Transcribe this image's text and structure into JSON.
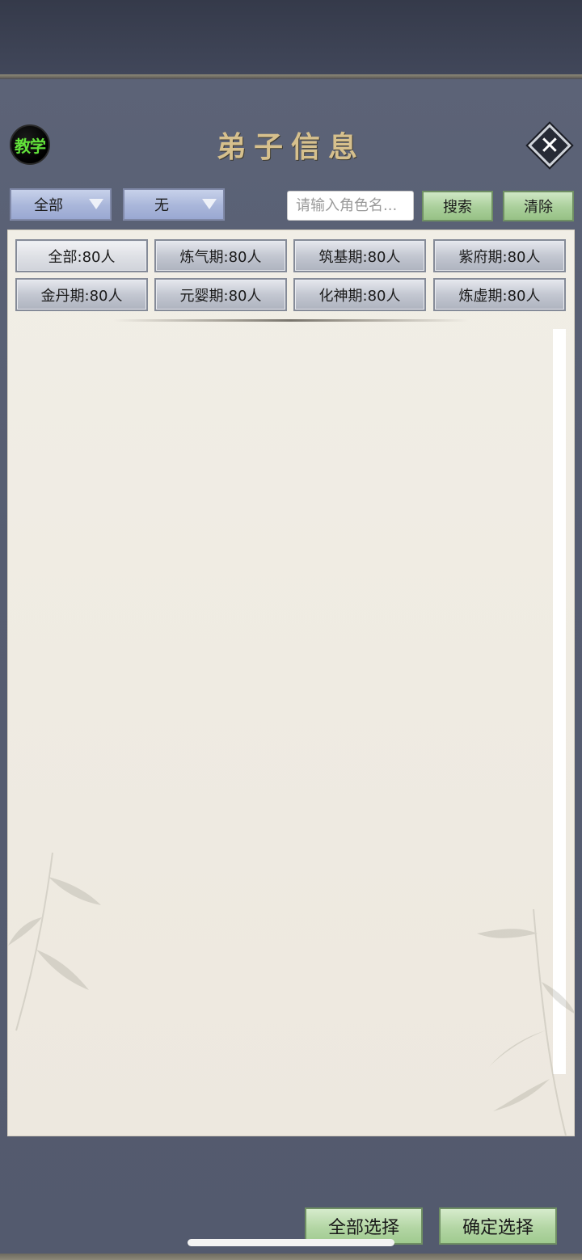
{
  "header": {
    "teach_label": "教学",
    "title": "弟子信息",
    "close_symbol": "✕"
  },
  "toolbar": {
    "dropdown_1": {
      "value": "全部"
    },
    "dropdown_2": {
      "value": "无"
    },
    "search": {
      "placeholder": "请输入角色名...",
      "value": ""
    },
    "search_label": "搜索",
    "clear_label": "清除"
  },
  "filters": [
    {
      "label": "全部:80人",
      "selected": true
    },
    {
      "label": "炼气期:80人",
      "selected": false
    },
    {
      "label": "筑基期:80人",
      "selected": false
    },
    {
      "label": "紫府期:80人",
      "selected": false
    },
    {
      "label": "金丹期:80人",
      "selected": false
    },
    {
      "label": "元婴期:80人",
      "selected": false
    },
    {
      "label": "化神期:80人",
      "selected": false
    },
    {
      "label": "炼虚期:80人",
      "selected": false
    }
  ],
  "footer": {
    "select_all_label": "全部选择",
    "confirm_label": "确定选择"
  },
  "colors": {
    "title_gold": "#d6c08d",
    "teach_green": "#62e23a",
    "panel_bg": "#5c6377",
    "content_bg": "#f1eee6",
    "button_green": "#b3d6a4",
    "dropdown_blue": "#a9b6da"
  }
}
